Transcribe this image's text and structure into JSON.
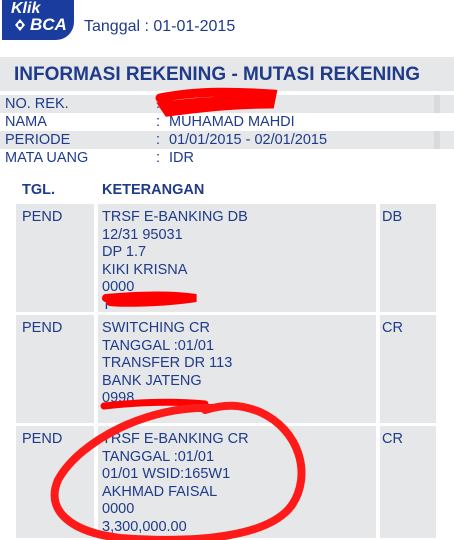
{
  "header": {
    "logo_klik": "Klik",
    "logo_bca": "BCA",
    "date_label": "Tanggal : 01-01-2015"
  },
  "title": "INFORMASI REKENING - MUTASI REKENING",
  "account": [
    {
      "label": "NO. REK.",
      "colon": ":",
      "value": ""
    },
    {
      "label": "NAMA",
      "colon": ":",
      "value": "MUHAMAD MAHDI"
    },
    {
      "label": "PERIODE",
      "colon": ":",
      "value": "01/01/2015 - 02/01/2015"
    },
    {
      "label": "MATA UANG",
      "colon": ":",
      "value": "IDR"
    }
  ],
  "table": {
    "headers": {
      "tgl": "TGL.",
      "keterangan": "KETERANGAN"
    },
    "rows": [
      {
        "tgl": "PEND",
        "lines": [
          "TRSF E-BANKING DB",
          "12/31 95031",
          "DP 1.7",
          "KIKI KRISNA",
          "0000",
          "T"
        ],
        "type": "DB"
      },
      {
        "tgl": "PEND",
        "lines": [
          "SWITCHING CR",
          "TANGGAL :01/01",
          "TRANSFER DR 113",
          "BANK JATENG",
          "0998",
          ""
        ],
        "type": "CR"
      },
      {
        "tgl": "PEND",
        "lines": [
          "TRSF E-BANKING CR",
          "TANGGAL :01/01",
          "01/01 WSID:165W1",
          "AKHMAD FAISAL",
          "0000",
          "3,300,000.00"
        ],
        "type": "CR"
      }
    ]
  },
  "colors": {
    "brand_blue": "#1a3c9e",
    "text_blue": "#1f3b8a",
    "row_gray": "#e6e7e9",
    "marker_red": "#ff1a1a",
    "redaction": "#ff0000"
  }
}
